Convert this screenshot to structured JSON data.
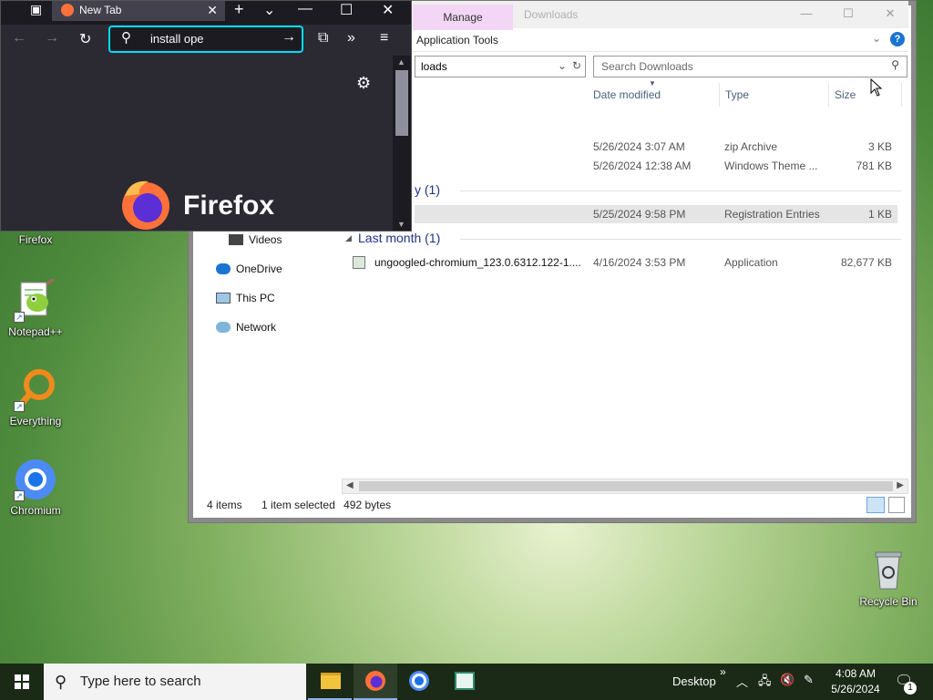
{
  "desktop": {
    "icons": [
      {
        "label": "Firefox"
      },
      {
        "label": "Notepad++"
      },
      {
        "label": "Everything"
      },
      {
        "label": "Chromium"
      },
      {
        "label": "Recycle Bin"
      }
    ]
  },
  "explorer": {
    "manage_tab": "Manage",
    "ghost_title": "Downloads",
    "ribbon_label": "Application Tools",
    "address_fragment": "loads",
    "search_placeholder": "Search Downloads",
    "columns": {
      "date": "Date modified",
      "type": "Type",
      "size": "Size"
    },
    "rows": [
      {
        "date": "5/26/2024 3:07 AM",
        "type": "zip Archive",
        "size": "3 KB"
      },
      {
        "date": "5/26/2024 12:38 AM",
        "type": "Windows Theme ...",
        "size": "781 KB"
      },
      {
        "date": "5/25/2024 9:58 PM",
        "type": "Registration Entries",
        "size": "1 KB"
      },
      {
        "name": "ungoogled-chromium_123.0.6312.122-1....",
        "date": "4/16/2024 3:53 PM",
        "type": "Application",
        "size": "82,677 KB"
      }
    ],
    "group_yesterday_fragment": "y (1)",
    "group_last_month": "Last month (1)",
    "nav": [
      "Videos",
      "OneDrive",
      "This PC",
      "Network"
    ],
    "status": {
      "items": "4 items",
      "selected": "1 item selected",
      "bytes": "492 bytes"
    }
  },
  "firefox": {
    "tab_title": "New Tab",
    "url_value": "install ope",
    "wordmark": "Firefox"
  },
  "taskbar": {
    "search_placeholder": "Type here to search",
    "desktop_label": "Desktop",
    "chevron": "»",
    "time": "4:08 AM",
    "date": "5/26/2024",
    "notification_count": "1"
  },
  "colors": {
    "firefox_accent": "#00ddff",
    "explorer_group": "#1e3287",
    "manage_tab": "#f3d6f5"
  }
}
